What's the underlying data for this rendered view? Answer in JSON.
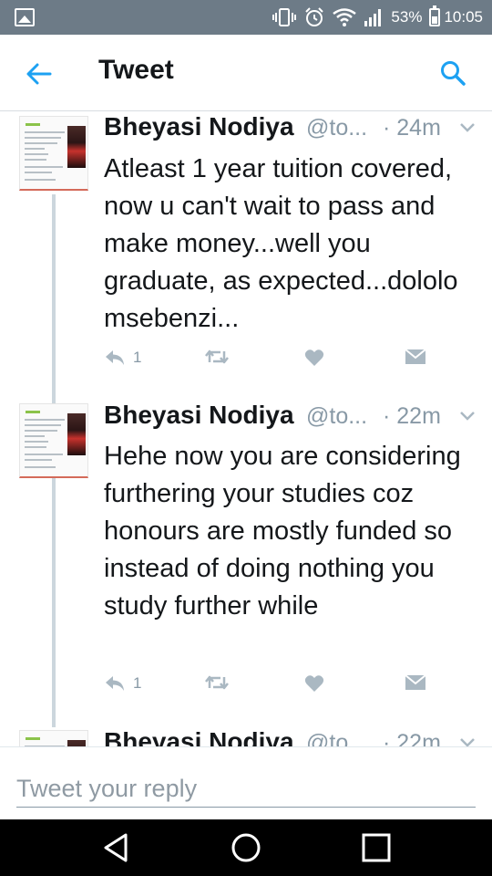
{
  "status_bar": {
    "battery": "53%",
    "time": "10:05",
    "icons": [
      "gallery-icon",
      "vibrate-icon",
      "alarm-icon",
      "wifi-icon",
      "signal-icon",
      "battery-icon"
    ]
  },
  "header": {
    "title": "Tweet",
    "back_icon": "arrow-left-icon",
    "search_icon": "search-icon",
    "accent_color": "#1da1f2"
  },
  "tweets": [
    {
      "author": "Bheyasi Nodiya",
      "handle": "@to...",
      "time": "· 24m",
      "text": "Atleast 1 year tuition covered, now u can't wait to pass and make money...well you graduate, as expected...dololo msebenzi...",
      "reply_count": "1"
    },
    {
      "author": "Bheyasi Nodiya",
      "handle": "@to...",
      "time": "· 22m",
      "text": "Hehe now you are considering furthering your studies coz honours are mostly funded so instead of doing nothing you study further while",
      "reply_count": "1"
    },
    {
      "author": "Bheyasi Nodiya",
      "handle": "@to...",
      "time": "· 22m"
    }
  ],
  "reply": {
    "placeholder": "Tweet your reply"
  },
  "nav": {
    "icons": [
      "back-triangle-icon",
      "home-circle-icon",
      "recents-square-icon"
    ]
  }
}
